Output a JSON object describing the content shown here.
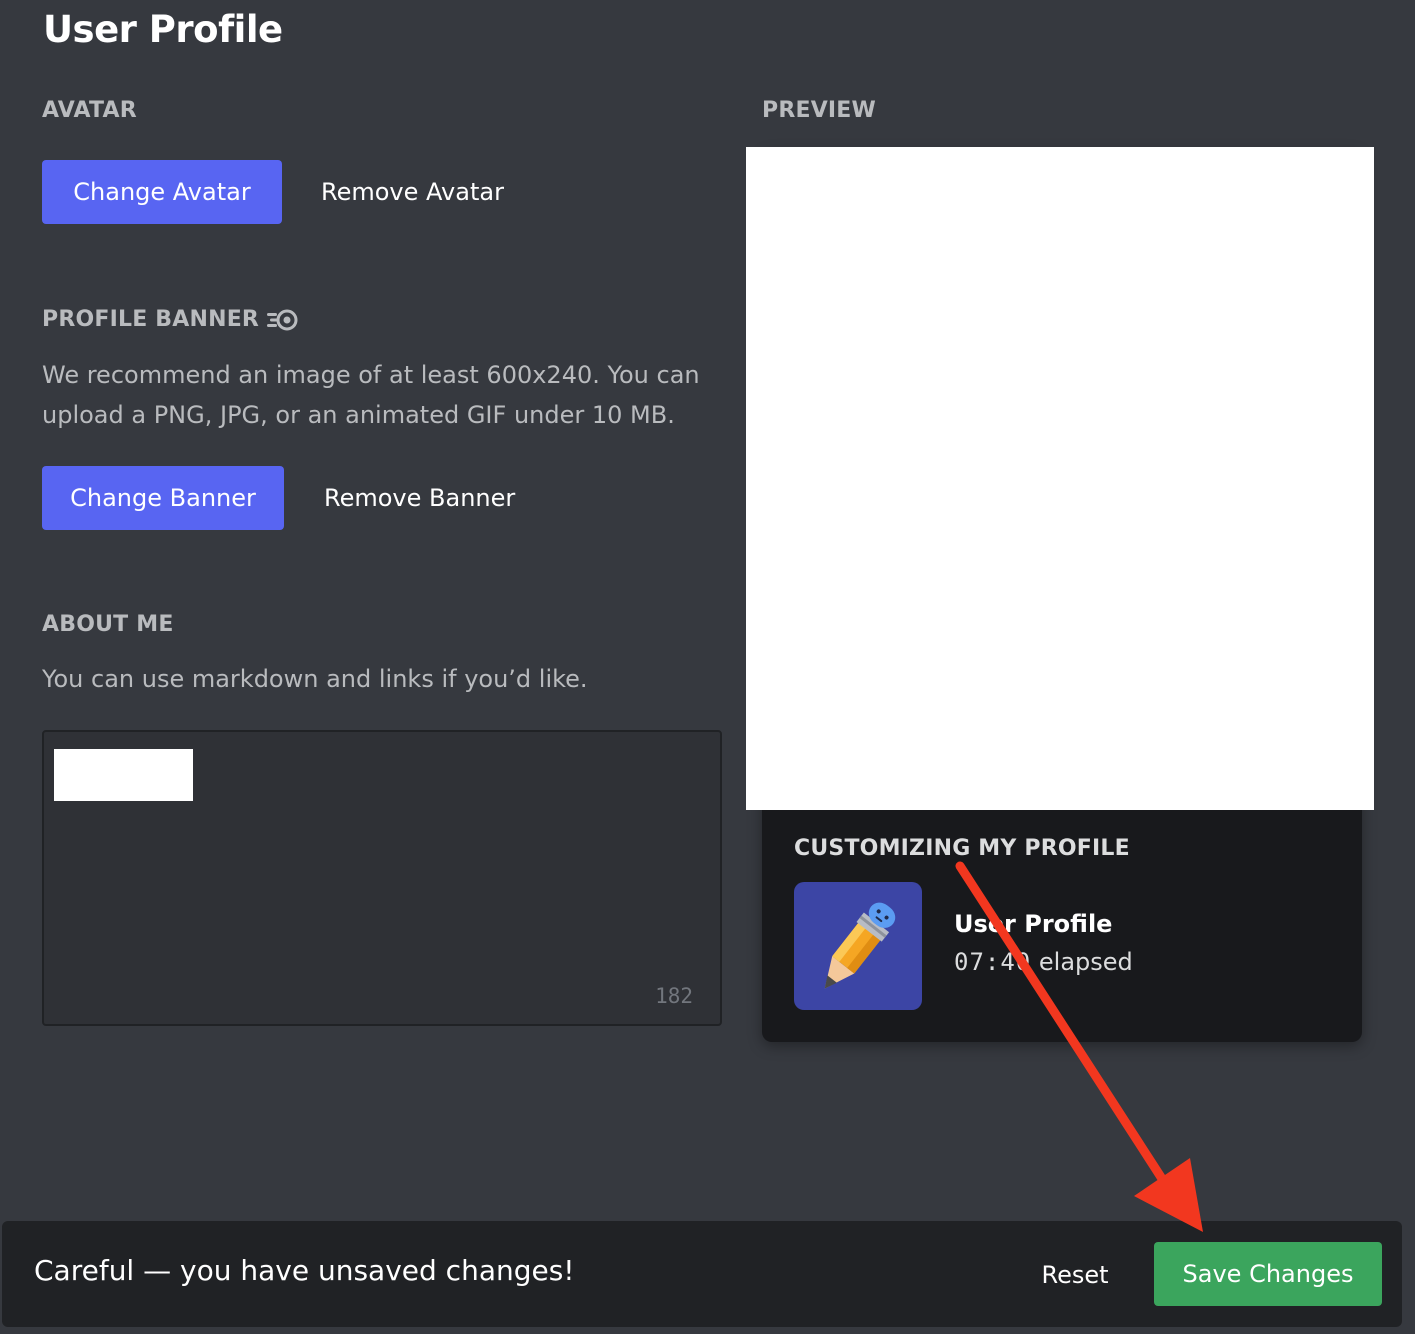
{
  "page": {
    "title": "User Profile"
  },
  "avatar": {
    "header": "AVATAR",
    "change_label": "Change Avatar",
    "remove_label": "Remove Avatar"
  },
  "banner": {
    "header": "PROFILE BANNER",
    "header_icon": "nitro-icon",
    "description": "We recommend an image of at least 600x240. You can upload a PNG, JPG, or an animated GIF under 10 MB.",
    "change_label": "Change Banner",
    "remove_label": "Remove Banner"
  },
  "about": {
    "header": "ABOUT ME",
    "description": "You can use markdown and links if you’d like.",
    "char_count": "182"
  },
  "preview": {
    "header": "PREVIEW",
    "activity_header": "CUSTOMIZING MY PROFILE",
    "activity_title": "User Profile",
    "elapsed_time": "07:40",
    "elapsed_suffix": "elapsed"
  },
  "notice": {
    "message": "Careful — you have unsaved changes!",
    "reset_label": "Reset",
    "save_label": "Save Changes"
  },
  "colors": {
    "background": "#36393f",
    "brand": "#5865f2",
    "success": "#3ba55d",
    "card": "#18191c",
    "notice_bg": "#202225",
    "annotation_arrow": "#f2371f"
  }
}
